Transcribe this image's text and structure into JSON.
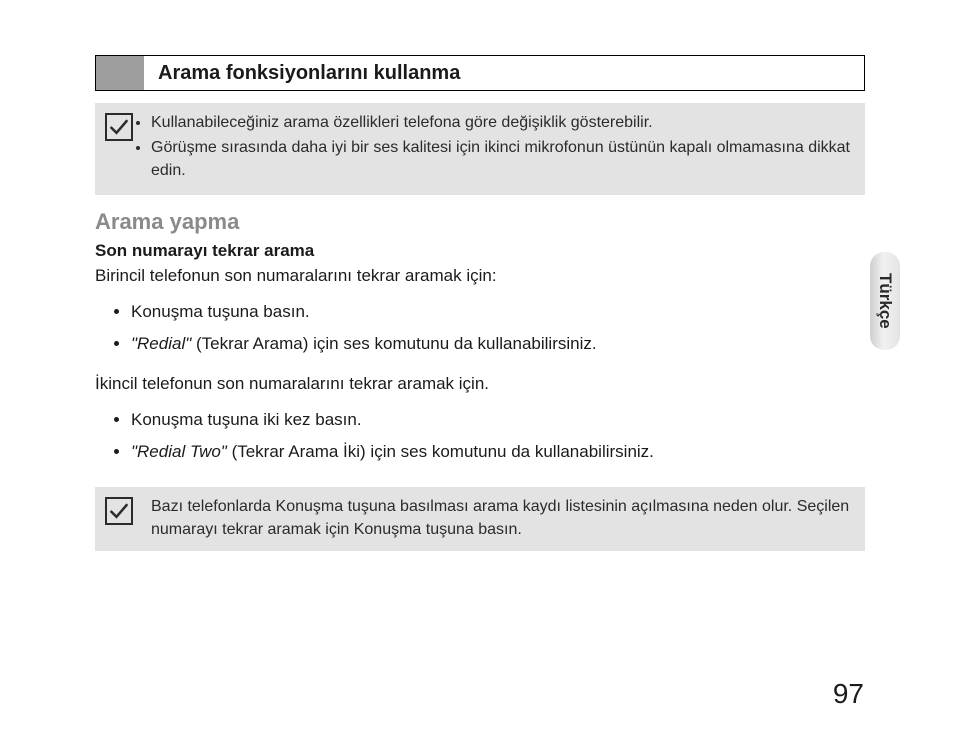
{
  "section": {
    "title": "Arama fonksiyonlarını kullanma"
  },
  "note1": {
    "items": [
      "Kullanabileceğiniz arama özellikleri telefona göre değişiklik gösterebilir.",
      "Görüşme sırasında daha iyi bir ses kalitesi için ikinci mikrofonun üstünün kapalı olmamasına dikkat edin."
    ]
  },
  "body": {
    "subheading": "Arama yapma",
    "subsub": "Son numarayı tekrar arama",
    "para1": "Birincil telefonun son numaralarını tekrar aramak için:",
    "list1": {
      "i0": "Konuşma tuşuna basın.",
      "i1_quote": "\"Redial\"",
      "i1_rest": " (Tekrar Arama) için ses komutunu da kullanabilirsiniz."
    },
    "para2": "İkincil telefonun son numaralarını tekrar aramak için.",
    "list2": {
      "i0": "Konuşma tuşuna iki kez basın.",
      "i1_quote": "\"Redial Two\"",
      "i1_rest": " (Tekrar Arama İki) için ses komutunu da kullanabilirsiniz."
    }
  },
  "note2": {
    "text": "Bazı telefonlarda Konuşma tuşuna basılması arama kaydı listesinin açılmasına neden olur. Seçilen numarayı tekrar aramak için Konuşma tuşuna basın."
  },
  "sideTab": "Türkçe",
  "pageNumber": "97"
}
